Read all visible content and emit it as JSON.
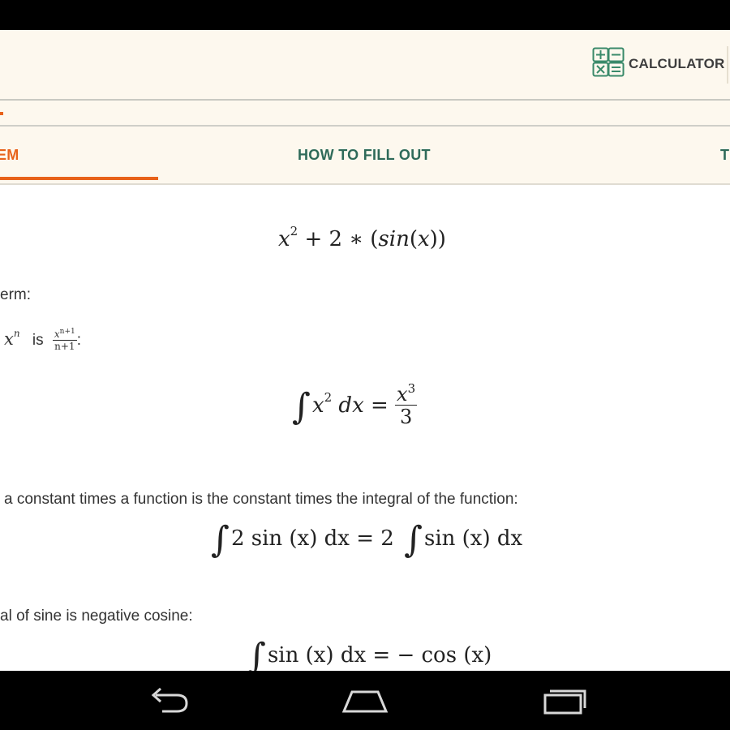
{
  "toolbar": {
    "calculator_label": "CALCULATOR"
  },
  "tabs": {
    "problem": "EM",
    "how_to_fill_out": "HOW TO FILL OUT",
    "next": "T"
  },
  "steps": {
    "problem_expr": {
      "x": "x",
      "exp2": "2",
      "rest": "+ 2 ∗ (",
      "sin": "sin",
      "open": "(",
      "x2": "x",
      "close": "))"
    },
    "line_term": "erm:",
    "power_rule": {
      "x": "x",
      "n": "n",
      "is": "is",
      "num": "x",
      "num_exp": "n+1",
      "den": "n+1",
      "colon": ":"
    },
    "integral_1": {
      "x": "x",
      "exp": "2",
      "dx": "dx =",
      "num": "x",
      "num_exp": "3",
      "den": "3"
    },
    "constant_text": "a constant times a function is the constant times the integral of the function:",
    "integral_2": {
      "lhs": "2 sin (x) dx = 2",
      "rhs": "sin (x) dx"
    },
    "sine_text": "al of sine is negative cosine:",
    "integral_3": {
      "lhs": "sin (x) dx = − cos (x)"
    }
  },
  "nav": {
    "back": "back-icon",
    "home": "home-icon",
    "recents": "recents-icon"
  }
}
